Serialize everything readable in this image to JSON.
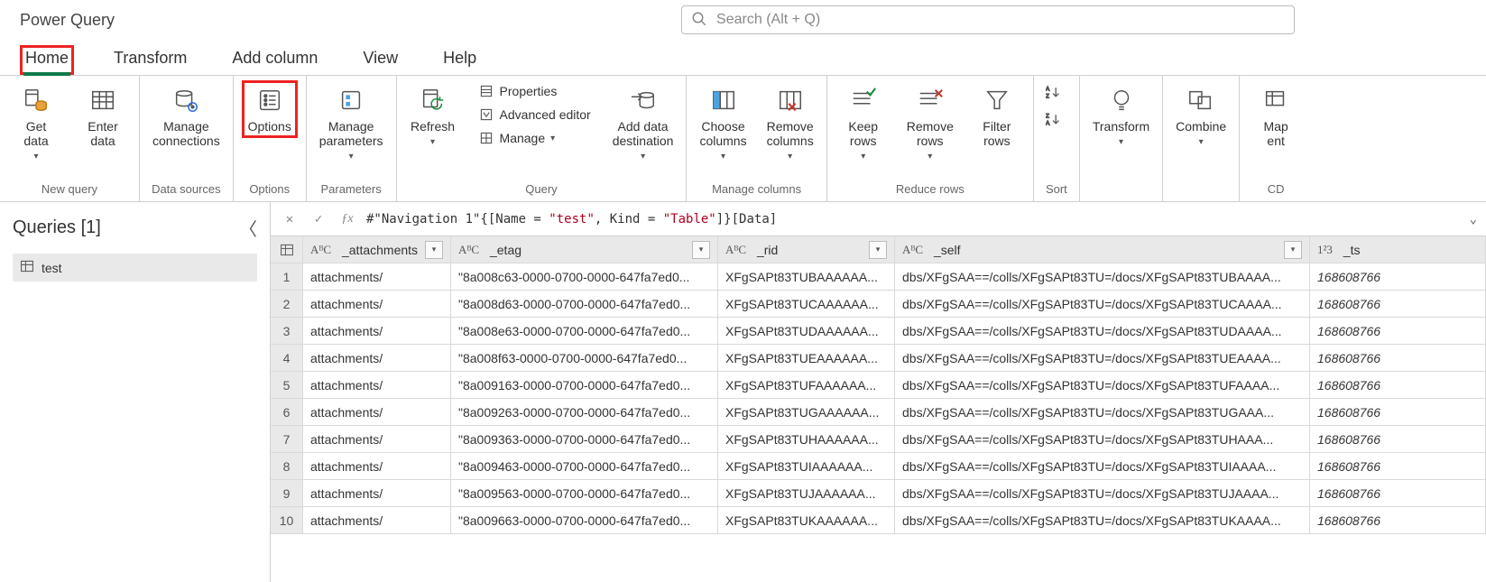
{
  "app_title": "Power Query",
  "search": {
    "placeholder": "Search (Alt + Q)"
  },
  "tabs": {
    "home": "Home",
    "transform": "Transform",
    "addcol": "Add column",
    "view": "View",
    "help": "Help"
  },
  "ribbon": {
    "groups": {
      "newquery": "New query",
      "datasources": "Data sources",
      "options": "Options",
      "parameters": "Parameters",
      "query": "Query",
      "managecols": "Manage columns",
      "reducerows": "Reduce rows",
      "sort": "Sort",
      "transform": "",
      "combine": "",
      "cdm": "CD"
    },
    "btn": {
      "getdata": "Get\ndata",
      "enterdata": "Enter\ndata",
      "manageconn": "Manage\nconnections",
      "options": "Options",
      "manageparams": "Manage\nparameters",
      "refresh": "Refresh",
      "properties": "Properties",
      "adveditor": "Advanced editor",
      "manage": "Manage",
      "adddest": "Add data\ndestination",
      "choosecols": "Choose\ncolumns",
      "removecols": "Remove\ncolumns",
      "keeprows": "Keep\nrows",
      "removerows": "Remove\nrows",
      "filterrows": "Filter\nrows",
      "transform": "Transform",
      "combine": "Combine",
      "mapent": "Map\nent"
    }
  },
  "queries": {
    "title": "Queries [1]",
    "items": [
      "test"
    ]
  },
  "formula": {
    "prefix": "#\"Navigation 1\"{[Name = ",
    "v1": "\"test\"",
    "mid": ", Kind = ",
    "v2": "\"Table\"",
    "suffix": "]}[Data]"
  },
  "columns": {
    "attachments": "_attachments",
    "etag": "_etag",
    "rid": "_rid",
    "self": "_self",
    "ts": "_ts"
  },
  "type_abc": "AᴮC",
  "type_123": "1²3",
  "rows": [
    {
      "n": "1",
      "att": "attachments/",
      "etag": "\"8a008c63-0000-0700-0000-647fa7ed0...",
      "rid": "XFgSAPt83TUBAAAAAA...",
      "self": "dbs/XFgSAA==/colls/XFgSAPt83TU=/docs/XFgSAPt83TUBAAAA...",
      "ts": "168608766"
    },
    {
      "n": "2",
      "att": "attachments/",
      "etag": "\"8a008d63-0000-0700-0000-647fa7ed0...",
      "rid": "XFgSAPt83TUCAAAAAA...",
      "self": "dbs/XFgSAA==/colls/XFgSAPt83TU=/docs/XFgSAPt83TUCAAAA...",
      "ts": "168608766"
    },
    {
      "n": "3",
      "att": "attachments/",
      "etag": "\"8a008e63-0000-0700-0000-647fa7ed0...",
      "rid": "XFgSAPt83TUDAAAAAA...",
      "self": "dbs/XFgSAA==/colls/XFgSAPt83TU=/docs/XFgSAPt83TUDAAAA...",
      "ts": "168608766"
    },
    {
      "n": "4",
      "att": "attachments/",
      "etag": "\"8a008f63-0000-0700-0000-647fa7ed0...",
      "rid": "XFgSAPt83TUEAAAAAA...",
      "self": "dbs/XFgSAA==/colls/XFgSAPt83TU=/docs/XFgSAPt83TUEAAAA...",
      "ts": "168608766"
    },
    {
      "n": "5",
      "att": "attachments/",
      "etag": "\"8a009163-0000-0700-0000-647fa7ed0...",
      "rid": "XFgSAPt83TUFAAAAAA...",
      "self": "dbs/XFgSAA==/colls/XFgSAPt83TU=/docs/XFgSAPt83TUFAAAA...",
      "ts": "168608766"
    },
    {
      "n": "6",
      "att": "attachments/",
      "etag": "\"8a009263-0000-0700-0000-647fa7ed0...",
      "rid": "XFgSAPt83TUGAAAAAA...",
      "self": "dbs/XFgSAA==/colls/XFgSAPt83TU=/docs/XFgSAPt83TUGAAA...",
      "ts": "168608766"
    },
    {
      "n": "7",
      "att": "attachments/",
      "etag": "\"8a009363-0000-0700-0000-647fa7ed0...",
      "rid": "XFgSAPt83TUHAAAAAA...",
      "self": "dbs/XFgSAA==/colls/XFgSAPt83TU=/docs/XFgSAPt83TUHAAA...",
      "ts": "168608766"
    },
    {
      "n": "8",
      "att": "attachments/",
      "etag": "\"8a009463-0000-0700-0000-647fa7ed0...",
      "rid": "XFgSAPt83TUIAAAAAA...",
      "self": "dbs/XFgSAA==/colls/XFgSAPt83TU=/docs/XFgSAPt83TUIAAAA...",
      "ts": "168608766"
    },
    {
      "n": "9",
      "att": "attachments/",
      "etag": "\"8a009563-0000-0700-0000-647fa7ed0...",
      "rid": "XFgSAPt83TUJAAAAAA...",
      "self": "dbs/XFgSAA==/colls/XFgSAPt83TU=/docs/XFgSAPt83TUJAAAA...",
      "ts": "168608766"
    },
    {
      "n": "10",
      "att": "attachments/",
      "etag": "\"8a009663-0000-0700-0000-647fa7ed0...",
      "rid": "XFgSAPt83TUKAAAAAA...",
      "self": "dbs/XFgSAA==/colls/XFgSAPt83TU=/docs/XFgSAPt83TUKAAAA...",
      "ts": "168608766"
    }
  ]
}
